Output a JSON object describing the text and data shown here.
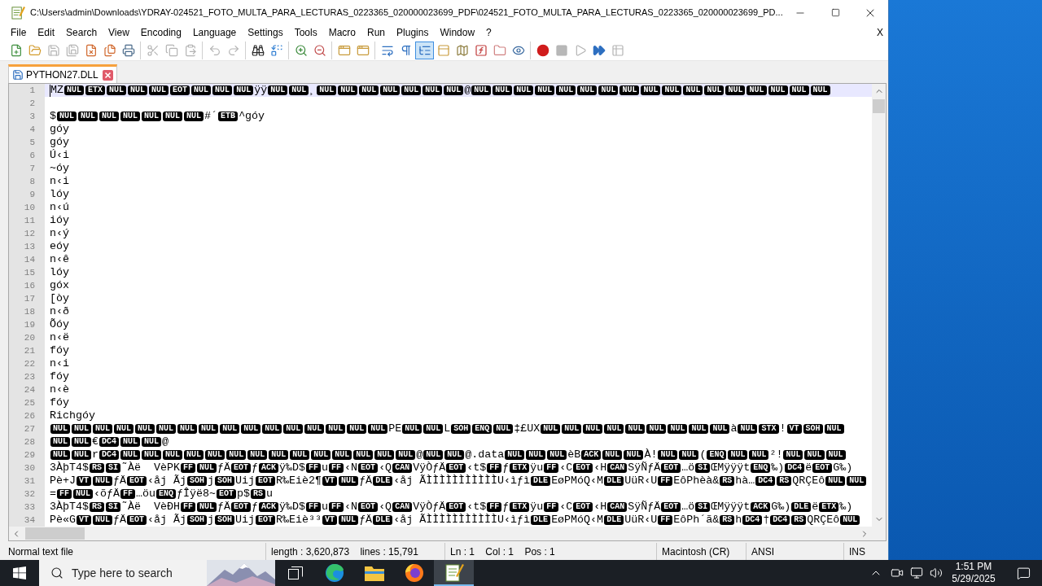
{
  "window": {
    "title": "C:\\Users\\admin\\Downloads\\YDRAY-024521_FOTO_MULTA_PARA_LECTURAS_0223365_020000023699_PDF\\024521_FOTO_MULTA_PARA_LECTURAS_0223365_020000023699_PD..."
  },
  "menu": {
    "items": [
      "File",
      "Edit",
      "Search",
      "View",
      "Encoding",
      "Language",
      "Settings",
      "Tools",
      "Macro",
      "Run",
      "Plugins",
      "Window",
      "?"
    ],
    "close_document": "X"
  },
  "toolbar": {
    "groups": [
      [
        {
          "kind": "new",
          "active": false,
          "disabled": false
        },
        {
          "kind": "open",
          "active": false,
          "disabled": false
        },
        {
          "kind": "save",
          "active": false,
          "disabled": true
        },
        {
          "kind": "save-all",
          "active": false,
          "disabled": true
        },
        {
          "kind": "close",
          "active": false,
          "disabled": false
        },
        {
          "kind": "close-all",
          "active": false,
          "disabled": false
        },
        {
          "kind": "print",
          "active": false,
          "disabled": false
        }
      ],
      [
        {
          "kind": "cut",
          "active": false,
          "disabled": true
        },
        {
          "kind": "copy",
          "active": false,
          "disabled": true
        },
        {
          "kind": "paste",
          "active": false,
          "disabled": true
        }
      ],
      [
        {
          "kind": "undo",
          "active": false,
          "disabled": true
        },
        {
          "kind": "redo",
          "active": false,
          "disabled": true
        }
      ],
      [
        {
          "kind": "find",
          "active": false,
          "disabled": false
        },
        {
          "kind": "replace",
          "active": false,
          "disabled": false
        }
      ],
      [
        {
          "kind": "zoom-in",
          "active": false,
          "disabled": false
        },
        {
          "kind": "zoom-out",
          "active": false,
          "disabled": false
        }
      ],
      [
        {
          "kind": "sync-vertical",
          "active": false,
          "disabled": false
        },
        {
          "kind": "sync-horizontal",
          "active": false,
          "disabled": false
        }
      ],
      [
        {
          "kind": "word-wrap",
          "active": false,
          "disabled": false
        },
        {
          "kind": "all-characters",
          "active": false,
          "disabled": false
        },
        {
          "kind": "indent-guide",
          "active": true,
          "disabled": false
        },
        {
          "kind": "language",
          "active": false,
          "disabled": false
        },
        {
          "kind": "document-map",
          "active": false,
          "disabled": false
        },
        {
          "kind": "function-list",
          "active": false,
          "disabled": false
        },
        {
          "kind": "folder-workspace",
          "active": false,
          "disabled": false
        },
        {
          "kind": "monitoring",
          "active": false,
          "disabled": false
        }
      ],
      [
        {
          "kind": "record",
          "active": false,
          "disabled": false
        },
        {
          "kind": "stop",
          "active": false,
          "disabled": true
        },
        {
          "kind": "play",
          "active": false,
          "disabled": true
        },
        {
          "kind": "play-multiple",
          "active": false,
          "disabled": false
        },
        {
          "kind": "save-macro",
          "active": false,
          "disabled": true
        }
      ]
    ]
  },
  "tabs": [
    {
      "label": "PYTHON27.DLL",
      "selected": true
    }
  ],
  "editor": {
    "lines": [
      {
        "number": "1",
        "current": true,
        "tokens": [
          {
            "kind": "text",
            "text": "MZ"
          },
          {
            "kind": "ctrl",
            "text": "NUL"
          },
          {
            "kind": "ctrl",
            "text": "ETX"
          },
          {
            "kind": "ctrl",
            "text": "NUL"
          },
          {
            "kind": "ctrl",
            "text": "NUL"
          },
          {
            "kind": "ctrl",
            "text": "NUL"
          },
          {
            "kind": "ctrl",
            "text": "EOT"
          },
          {
            "kind": "ctrl",
            "text": "NUL"
          },
          {
            "kind": "ctrl",
            "text": "NUL"
          },
          {
            "kind": "ctrl",
            "text": "NUL"
          },
          {
            "kind": "text",
            "text": "ÿÿ"
          },
          {
            "kind": "ctrl",
            "text": "NUL"
          },
          {
            "kind": "ctrl",
            "text": "NUL"
          },
          {
            "kind": "text",
            "text": "¸"
          },
          {
            "kind": "ctrl",
            "text": "NUL"
          },
          {
            "kind": "ctrl",
            "text": "NUL"
          },
          {
            "kind": "ctrl",
            "text": "NUL"
          },
          {
            "kind": "ctrl",
            "text": "NUL"
          },
          {
            "kind": "ctrl",
            "text": "NUL"
          },
          {
            "kind": "ctrl",
            "text": "NUL"
          },
          {
            "kind": "ctrl",
            "text": "NUL"
          },
          {
            "kind": "text",
            "text": "@"
          },
          {
            "kind": "ctrl",
            "text": "NUL"
          },
          {
            "kind": "ctrl",
            "text": "NUL"
          },
          {
            "kind": "ctrl",
            "text": "NUL"
          },
          {
            "kind": "ctrl",
            "text": "NUL"
          },
          {
            "kind": "ctrl",
            "text": "NUL"
          },
          {
            "kind": "ctrl",
            "text": "NUL"
          },
          {
            "kind": "ctrl",
            "text": "NUL"
          },
          {
            "kind": "ctrl",
            "text": "NUL"
          },
          {
            "kind": "ctrl",
            "text": "NUL"
          },
          {
            "kind": "ctrl",
            "text": "NUL"
          },
          {
            "kind": "ctrl",
            "text": "NUL"
          },
          {
            "kind": "ctrl",
            "text": "NUL"
          },
          {
            "kind": "ctrl",
            "text": "NUL"
          },
          {
            "kind": "ctrl",
            "text": "NUL"
          },
          {
            "kind": "ctrl",
            "text": "NUL"
          },
          {
            "kind": "ctrl",
            "text": "NUL"
          },
          {
            "kind": "ctrl",
            "text": "NUL"
          }
        ]
      },
      {
        "number": "2",
        "current": false
      },
      {
        "number": "3",
        "current": false,
        "tokens": [
          {
            "kind": "text",
            "text": "$"
          },
          {
            "kind": "ctrl",
            "text": "NUL"
          },
          {
            "kind": "ctrl",
            "text": "NUL"
          },
          {
            "kind": "ctrl",
            "text": "NUL"
          },
          {
            "kind": "ctrl",
            "text": "NUL"
          },
          {
            "kind": "ctrl",
            "text": "NUL"
          },
          {
            "kind": "ctrl",
            "text": "NUL"
          },
          {
            "kind": "ctrl",
            "text": "NUL"
          },
          {
            "kind": "text",
            "text": "#´"
          },
          {
            "kind": "ctrl",
            "text": "ETB"
          },
          {
            "kind": "text",
            "text": "^góy"
          }
        ]
      },
      {
        "number": "4",
        "current": false,
        "tokens": [
          {
            "kind": "text",
            "text": "góy"
          }
        ]
      },
      {
        "number": "5",
        "current": false,
        "tokens": [
          {
            "kind": "text",
            "text": "góy"
          }
        ]
      },
      {
        "number": "6",
        "current": false,
        "tokens": [
          {
            "kind": "text",
            "text": "Ú‹i"
          }
        ]
      },
      {
        "number": "7",
        "current": false,
        "tokens": [
          {
            "kind": "text",
            "text": "~óy"
          }
        ]
      },
      {
        "number": "8",
        "current": false,
        "tokens": [
          {
            "kind": "text",
            "text": "n‹i"
          }
        ]
      },
      {
        "number": "9",
        "current": false,
        "tokens": [
          {
            "kind": "text",
            "text": "lóy"
          }
        ]
      },
      {
        "number": "10",
        "current": false,
        "tokens": [
          {
            "kind": "text",
            "text": "n‹ú"
          }
        ]
      },
      {
        "number": "11",
        "current": false,
        "tokens": [
          {
            "kind": "text",
            "text": "ióy"
          }
        ]
      },
      {
        "number": "12",
        "current": false,
        "tokens": [
          {
            "kind": "text",
            "text": "n‹ý"
          }
        ]
      },
      {
        "number": "13",
        "current": false,
        "tokens": [
          {
            "kind": "text",
            "text": "eóy"
          }
        ]
      },
      {
        "number": "14",
        "current": false,
        "tokens": [
          {
            "kind": "text",
            "text": "n‹ê"
          }
        ]
      },
      {
        "number": "15",
        "current": false,
        "tokens": [
          {
            "kind": "text",
            "text": "lóy"
          }
        ]
      },
      {
        "number": "16",
        "current": false,
        "tokens": [
          {
            "kind": "text",
            "text": "góx"
          }
        ]
      },
      {
        "number": "17",
        "current": false,
        "tokens": [
          {
            "kind": "text",
            "text": "[òy"
          }
        ]
      },
      {
        "number": "18",
        "current": false,
        "tokens": [
          {
            "kind": "text",
            "text": "n‹ð"
          }
        ]
      },
      {
        "number": "19",
        "current": false,
        "tokens": [
          {
            "kind": "text",
            "text": "Õóy"
          }
        ]
      },
      {
        "number": "20",
        "current": false,
        "tokens": [
          {
            "kind": "text",
            "text": "n‹ë"
          }
        ]
      },
      {
        "number": "21",
        "current": false,
        "tokens": [
          {
            "kind": "text",
            "text": "fóy"
          }
        ]
      },
      {
        "number": "22",
        "current": false,
        "tokens": [
          {
            "kind": "text",
            "text": "n‹i"
          }
        ]
      },
      {
        "number": "23",
        "current": false,
        "tokens": [
          {
            "kind": "text",
            "text": "fóy"
          }
        ]
      },
      {
        "number": "24",
        "current": false,
        "tokens": [
          {
            "kind": "text",
            "text": "n‹è"
          }
        ]
      },
      {
        "number": "25",
        "current": false,
        "tokens": [
          {
            "kind": "text",
            "text": "fóy"
          }
        ]
      },
      {
        "number": "26",
        "current": false,
        "tokens": [
          {
            "kind": "text",
            "text": "Richgóy"
          }
        ]
      },
      {
        "number": "27",
        "current": false,
        "tokens": [
          {
            "kind": "ctrl",
            "text": "NUL"
          },
          {
            "kind": "ctrl",
            "text": "NUL"
          },
          {
            "kind": "ctrl",
            "text": "NUL"
          },
          {
            "kind": "ctrl",
            "text": "NUL"
          },
          {
            "kind": "ctrl",
            "text": "NUL"
          },
          {
            "kind": "ctrl",
            "text": "NUL"
          },
          {
            "kind": "ctrl",
            "text": "NUL"
          },
          {
            "kind": "ctrl",
            "text": "NUL"
          },
          {
            "kind": "ctrl",
            "text": "NUL"
          },
          {
            "kind": "ctrl",
            "text": "NUL"
          },
          {
            "kind": "ctrl",
            "text": "NUL"
          },
          {
            "kind": "ctrl",
            "text": "NUL"
          },
          {
            "kind": "ctrl",
            "text": "NUL"
          },
          {
            "kind": "ctrl",
            "text": "NUL"
          },
          {
            "kind": "ctrl",
            "text": "NUL"
          },
          {
            "kind": "ctrl",
            "text": "NUL"
          },
          {
            "kind": "text",
            "text": "PE"
          },
          {
            "kind": "ctrl",
            "text": "NUL"
          },
          {
            "kind": "ctrl",
            "text": "NUL"
          },
          {
            "kind": "text",
            "text": "L"
          },
          {
            "kind": "ctrl",
            "text": "SOH"
          },
          {
            "kind": "ctrl",
            "text": "ENQ"
          },
          {
            "kind": "ctrl",
            "text": "NUL"
          },
          {
            "kind": "text",
            "text": "‡£UX"
          },
          {
            "kind": "ctrl",
            "text": "NUL"
          },
          {
            "kind": "ctrl",
            "text": "NUL"
          },
          {
            "kind": "ctrl",
            "text": "NUL"
          },
          {
            "kind": "ctrl",
            "text": "NUL"
          },
          {
            "kind": "ctrl",
            "text": "NUL"
          },
          {
            "kind": "ctrl",
            "text": "NUL"
          },
          {
            "kind": "ctrl",
            "text": "NUL"
          },
          {
            "kind": "ctrl",
            "text": "NUL"
          },
          {
            "kind": "ctrl",
            "text": "NUL"
          },
          {
            "kind": "text",
            "text": "à"
          },
          {
            "kind": "ctrl",
            "text": "NUL"
          },
          {
            "kind": "ctrl",
            "text": "STX"
          },
          {
            "kind": "text",
            "text": "!"
          },
          {
            "kind": "ctrl",
            "text": "VT"
          },
          {
            "kind": "ctrl",
            "text": "SOH"
          },
          {
            "kind": "ctrl",
            "text": "NUL"
          }
        ]
      },
      {
        "number": "28",
        "current": false,
        "tokens": [
          {
            "kind": "ctrl",
            "text": "NUL"
          },
          {
            "kind": "ctrl",
            "text": "NUL"
          },
          {
            "kind": "text",
            "text": "€"
          },
          {
            "kind": "ctrl",
            "text": "DC4"
          },
          {
            "kind": "ctrl",
            "text": "NUL"
          },
          {
            "kind": "ctrl",
            "text": "NUL"
          },
          {
            "kind": "text",
            "text": "@"
          }
        ]
      },
      {
        "number": "29",
        "current": false,
        "tokens": [
          {
            "kind": "ctrl",
            "text": "NUL"
          },
          {
            "kind": "ctrl",
            "text": "NUL"
          },
          {
            "kind": "text",
            "text": "r"
          },
          {
            "kind": "ctrl",
            "text": "DC4"
          },
          {
            "kind": "ctrl",
            "text": "NUL"
          },
          {
            "kind": "ctrl",
            "text": "NUL"
          },
          {
            "kind": "ctrl",
            "text": "NUL"
          },
          {
            "kind": "ctrl",
            "text": "NUL"
          },
          {
            "kind": "ctrl",
            "text": "NUL"
          },
          {
            "kind": "ctrl",
            "text": "NUL"
          },
          {
            "kind": "ctrl",
            "text": "NUL"
          },
          {
            "kind": "ctrl",
            "text": "NUL"
          },
          {
            "kind": "ctrl",
            "text": "NUL"
          },
          {
            "kind": "ctrl",
            "text": "NUL"
          },
          {
            "kind": "ctrl",
            "text": "NUL"
          },
          {
            "kind": "ctrl",
            "text": "NUL"
          },
          {
            "kind": "ctrl",
            "text": "NUL"
          },
          {
            "kind": "ctrl",
            "text": "NUL"
          },
          {
            "kind": "text",
            "text": "@"
          },
          {
            "kind": "ctrl",
            "text": "NUL"
          },
          {
            "kind": "ctrl",
            "text": "NUL"
          },
          {
            "kind": "text",
            "text": "@.data"
          },
          {
            "kind": "ctrl",
            "text": "NUL"
          },
          {
            "kind": "ctrl",
            "text": "NUL"
          },
          {
            "kind": "ctrl",
            "text": "NUL"
          },
          {
            "kind": "text",
            "text": "èB"
          },
          {
            "kind": "ctrl",
            "text": "ACK"
          },
          {
            "kind": "ctrl",
            "text": "NUL"
          },
          {
            "kind": "ctrl",
            "text": "NUL"
          },
          {
            "kind": "text",
            "text": "À!"
          },
          {
            "kind": "ctrl",
            "text": "NUL"
          },
          {
            "kind": "ctrl",
            "text": "NUL"
          },
          {
            "kind": "text",
            "text": "("
          },
          {
            "kind": "ctrl",
            "text": "ENQ"
          },
          {
            "kind": "ctrl",
            "text": "NUL"
          },
          {
            "kind": "ctrl",
            "text": "NUL"
          },
          {
            "kind": "text",
            "text": "²!"
          },
          {
            "kind": "ctrl",
            "text": "NUL"
          },
          {
            "kind": "ctrl",
            "text": "NUL"
          },
          {
            "kind": "ctrl",
            "text": "NUL"
          }
        ]
      },
      {
        "number": "30",
        "current": false,
        "tokens": [
          {
            "kind": "text",
            "text": "3ÀþT4$"
          },
          {
            "kind": "ctrl",
            "text": "RS"
          },
          {
            "kind": "ctrl",
            "text": "SI"
          },
          {
            "kind": "text",
            "text": "˜Àë  VèPK"
          },
          {
            "kind": "ctrl",
            "text": "FF"
          },
          {
            "kind": "ctrl",
            "text": "NUL"
          },
          {
            "kind": "text",
            "text": "ƒÄ"
          },
          {
            "kind": "ctrl",
            "text": "EOT"
          },
          {
            "kind": "text",
            "text": "ƒ"
          },
          {
            "kind": "ctrl",
            "text": "ACK"
          },
          {
            "kind": "text",
            "text": "ÿ‰D$"
          },
          {
            "kind": "ctrl",
            "text": "FF"
          },
          {
            "kind": "text",
            "text": "u"
          },
          {
            "kind": "ctrl",
            "text": "FF"
          },
          {
            "kind": "text",
            "text": "‹N"
          },
          {
            "kind": "ctrl",
            "text": "EOT"
          },
          {
            "kind": "text",
            "text": "‹Q"
          },
          {
            "kind": "ctrl",
            "text": "CAN"
          },
          {
            "kind": "text",
            "text": "VÿÒƒÄ"
          },
          {
            "kind": "ctrl",
            "text": "EOT"
          },
          {
            "kind": "text",
            "text": "‹t$"
          },
          {
            "kind": "ctrl",
            "text": "FF"
          },
          {
            "kind": "text",
            "text": "ƒ"
          },
          {
            "kind": "ctrl",
            "text": "ETX"
          },
          {
            "kind": "text",
            "text": "ÿu"
          },
          {
            "kind": "ctrl",
            "text": "FF"
          },
          {
            "kind": "text",
            "text": "‹C"
          },
          {
            "kind": "ctrl",
            "text": "EOT"
          },
          {
            "kind": "text",
            "text": "‹H"
          },
          {
            "kind": "ctrl",
            "text": "CAN"
          },
          {
            "kind": "text",
            "text": "SÿÑƒÄ"
          },
          {
            "kind": "ctrl",
            "text": "EOT"
          },
          {
            "kind": "text",
            "text": "…ö"
          },
          {
            "kind": "ctrl",
            "text": "SI"
          },
          {
            "kind": "text",
            "text": "ŒMÿÿÿt"
          },
          {
            "kind": "ctrl",
            "text": "ENQ"
          },
          {
            "kind": "text",
            "text": "‰)"
          },
          {
            "kind": "ctrl",
            "text": "DC4"
          },
          {
            "kind": "text",
            "text": "ë"
          },
          {
            "kind": "ctrl",
            "text": "EOT"
          },
          {
            "kind": "text",
            "text": "G‰)"
          }
        ]
      },
      {
        "number": "31",
        "current": false,
        "tokens": [
          {
            "kind": "text",
            "text": "Pè+J"
          },
          {
            "kind": "ctrl",
            "text": "VT"
          },
          {
            "kind": "ctrl",
            "text": "NUL"
          },
          {
            "kind": "text",
            "text": "ƒÄ"
          },
          {
            "kind": "ctrl",
            "text": "EOT"
          },
          {
            "kind": "text",
            "text": "‹åj Ãj"
          },
          {
            "kind": "ctrl",
            "text": "SOH"
          },
          {
            "kind": "text",
            "text": "j"
          },
          {
            "kind": "ctrl",
            "text": "SOH"
          },
          {
            "kind": "text",
            "text": "Uij"
          },
          {
            "kind": "ctrl",
            "text": "EOT"
          },
          {
            "kind": "text",
            "text": "R‰Eiè2¶"
          },
          {
            "kind": "ctrl",
            "text": "VT"
          },
          {
            "kind": "ctrl",
            "text": "NUL"
          },
          {
            "kind": "text",
            "text": "ƒÄ"
          },
          {
            "kind": "ctrl",
            "text": "DLE"
          },
          {
            "kind": "text",
            "text": "‹åj ÃÌÌÌÌÌÌÌÌÌÌÌU‹ìƒì"
          },
          {
            "kind": "ctrl",
            "text": "DLE"
          },
          {
            "kind": "text",
            "text": "EøPMóQ‹M"
          },
          {
            "kind": "ctrl",
            "text": "DLE"
          },
          {
            "kind": "text",
            "text": "UüR‹U"
          },
          {
            "kind": "ctrl",
            "text": "FF"
          },
          {
            "kind": "text",
            "text": "EôPhèà&"
          },
          {
            "kind": "ctrl",
            "text": "RS"
          },
          {
            "kind": "text",
            "text": "hà…"
          },
          {
            "kind": "ctrl",
            "text": "DC4"
          },
          {
            "kind": "ctrl",
            "text": "RS"
          },
          {
            "kind": "text",
            "text": "QRÇEô"
          },
          {
            "kind": "ctrl",
            "text": "NUL"
          },
          {
            "kind": "ctrl",
            "text": "NUL"
          }
        ]
      },
      {
        "number": "32",
        "current": false,
        "tokens": [
          {
            "kind": "text",
            "text": "="
          },
          {
            "kind": "ctrl",
            "text": "FF"
          },
          {
            "kind": "ctrl",
            "text": "NUL"
          },
          {
            "kind": "text",
            "text": "‹õƒÄ"
          },
          {
            "kind": "ctrl",
            "text": "FF"
          },
          {
            "kind": "text",
            "text": "…öu"
          },
          {
            "kind": "ctrl",
            "text": "ENQ"
          },
          {
            "kind": "text",
            "text": "ƒÎÿë8~"
          },
          {
            "kind": "ctrl",
            "text": "EOT"
          },
          {
            "kind": "text",
            "text": "p$"
          },
          {
            "kind": "ctrl",
            "text": "RS"
          },
          {
            "kind": "text",
            "text": "u"
          }
        ]
      },
      {
        "number": "33",
        "current": false,
        "tokens": [
          {
            "kind": "text",
            "text": "3ÀþT4$"
          },
          {
            "kind": "ctrl",
            "text": "RS"
          },
          {
            "kind": "ctrl",
            "text": "SI"
          },
          {
            "kind": "text",
            "text": "˜Àë  VèÐH"
          },
          {
            "kind": "ctrl",
            "text": "FF"
          },
          {
            "kind": "ctrl",
            "text": "NUL"
          },
          {
            "kind": "text",
            "text": "ƒÄ"
          },
          {
            "kind": "ctrl",
            "text": "EOT"
          },
          {
            "kind": "text",
            "text": "ƒ"
          },
          {
            "kind": "ctrl",
            "text": "ACK"
          },
          {
            "kind": "text",
            "text": "ÿ‰D$"
          },
          {
            "kind": "ctrl",
            "text": "FF"
          },
          {
            "kind": "text",
            "text": "u"
          },
          {
            "kind": "ctrl",
            "text": "FF"
          },
          {
            "kind": "text",
            "text": "‹N"
          },
          {
            "kind": "ctrl",
            "text": "EOT"
          },
          {
            "kind": "text",
            "text": "‹Q"
          },
          {
            "kind": "ctrl",
            "text": "CAN"
          },
          {
            "kind": "text",
            "text": "VÿÒƒÄ"
          },
          {
            "kind": "ctrl",
            "text": "EOT"
          },
          {
            "kind": "text",
            "text": "‹t$"
          },
          {
            "kind": "ctrl",
            "text": "FF"
          },
          {
            "kind": "text",
            "text": "ƒ"
          },
          {
            "kind": "ctrl",
            "text": "ETX"
          },
          {
            "kind": "text",
            "text": "ÿu"
          },
          {
            "kind": "ctrl",
            "text": "FF"
          },
          {
            "kind": "text",
            "text": "‹C"
          },
          {
            "kind": "ctrl",
            "text": "EOT"
          },
          {
            "kind": "text",
            "text": "‹H"
          },
          {
            "kind": "ctrl",
            "text": "CAN"
          },
          {
            "kind": "text",
            "text": "SÿÑƒÄ"
          },
          {
            "kind": "ctrl",
            "text": "EOT"
          },
          {
            "kind": "text",
            "text": "…ö"
          },
          {
            "kind": "ctrl",
            "text": "SI"
          },
          {
            "kind": "text",
            "text": "ŒMÿÿÿt"
          },
          {
            "kind": "ctrl",
            "text": "ACK"
          },
          {
            "kind": "text",
            "text": "G‰)"
          },
          {
            "kind": "ctrl",
            "text": "DLE"
          },
          {
            "kind": "text",
            "text": "ë"
          },
          {
            "kind": "ctrl",
            "text": "ETX"
          },
          {
            "kind": "text",
            "text": "‰)"
          }
        ]
      },
      {
        "number": "34",
        "current": false,
        "tokens": [
          {
            "kind": "text",
            "text": "Pè«G"
          },
          {
            "kind": "ctrl",
            "text": "VT"
          },
          {
            "kind": "ctrl",
            "text": "NUL"
          },
          {
            "kind": "text",
            "text": "ƒÄ"
          },
          {
            "kind": "ctrl",
            "text": "EOT"
          },
          {
            "kind": "text",
            "text": "‹åj Ãj"
          },
          {
            "kind": "ctrl",
            "text": "SOH"
          },
          {
            "kind": "text",
            "text": "j"
          },
          {
            "kind": "ctrl",
            "text": "SOH"
          },
          {
            "kind": "text",
            "text": "Uij"
          },
          {
            "kind": "ctrl",
            "text": "EOT"
          },
          {
            "kind": "text",
            "text": "R‰Eiè³³"
          },
          {
            "kind": "ctrl",
            "text": "VT"
          },
          {
            "kind": "ctrl",
            "text": "NUL"
          },
          {
            "kind": "text",
            "text": "ƒÄ"
          },
          {
            "kind": "ctrl",
            "text": "DLE"
          },
          {
            "kind": "text",
            "text": "‹åj ÃÌÌÌÌÌÌÌÌÌÌÌU‹ìƒì"
          },
          {
            "kind": "ctrl",
            "text": "DLE"
          },
          {
            "kind": "text",
            "text": "EøPMóQ‹M"
          },
          {
            "kind": "ctrl",
            "text": "DLE"
          },
          {
            "kind": "text",
            "text": "UüR‹U"
          },
          {
            "kind": "ctrl",
            "text": "FF"
          },
          {
            "kind": "text",
            "text": "EôPh´ã&"
          },
          {
            "kind": "ctrl",
            "text": "RS"
          },
          {
            "kind": "text",
            "text": "h"
          },
          {
            "kind": "ctrl",
            "text": "DC4"
          },
          {
            "kind": "text",
            "text": "†"
          },
          {
            "kind": "ctrl",
            "text": "DC4"
          },
          {
            "kind": "ctrl",
            "text": "RS"
          },
          {
            "kind": "text",
            "text": "QRÇEô"
          },
          {
            "kind": "ctrl",
            "text": "NUL"
          }
        ]
      }
    ]
  },
  "status_bar": [
    "Normal text file",
    "length : 3,620,873    lines : 15,791",
    "Ln : 1    Col : 1    Pos : 1",
    "Macintosh (CR)",
    "ANSI",
    "INS"
  ],
  "taskbar": {
    "search_placeholder": "Type here to search",
    "apps": [
      {
        "kind": "browser",
        "selected": false
      },
      {
        "kind": "files",
        "selected": false
      },
      {
        "kind": "fox",
        "selected": false
      },
      {
        "kind": "notepad",
        "selected": true
      }
    ],
    "clock": {
      "time": "1:51 PM",
      "date": "5/29/2025"
    }
  }
}
